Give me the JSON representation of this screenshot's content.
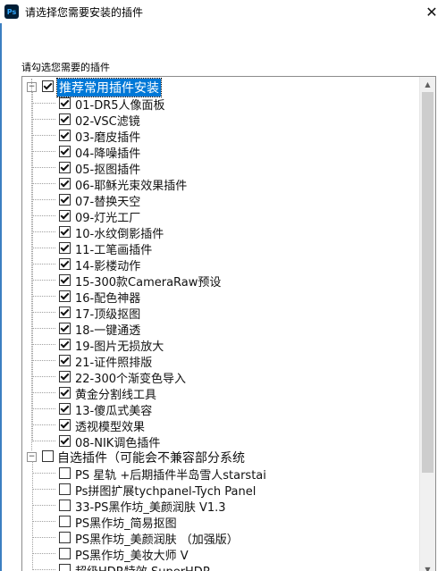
{
  "window": {
    "title": "请选择您需要安装的插件",
    "app_icon_text": "Ps",
    "close_glyph": "✕"
  },
  "prompt": "请勾选您需要的插件",
  "tree": {
    "groups": [
      {
        "label": "推荐常用插件安装",
        "checked": true,
        "expanded": true,
        "selected": true,
        "items": [
          {
            "label": "01-DR5人像面板",
            "checked": true
          },
          {
            "label": "02-VSC滤镜",
            "checked": true
          },
          {
            "label": "03-磨皮插件",
            "checked": true
          },
          {
            "label": "04-降噪插件",
            "checked": true
          },
          {
            "label": "05-抠图插件",
            "checked": true
          },
          {
            "label": "06-耶稣光束效果插件",
            "checked": true
          },
          {
            "label": "07-替换天空",
            "checked": true
          },
          {
            "label": "09-灯光工厂",
            "checked": true
          },
          {
            "label": "10-水纹倒影插件",
            "checked": true
          },
          {
            "label": "11-工笔画插件",
            "checked": true
          },
          {
            "label": "14-影楼动作",
            "checked": true
          },
          {
            "label": "15-300款CameraRaw预设",
            "checked": true
          },
          {
            "label": "16-配色神器",
            "checked": true
          },
          {
            "label": "17-顶级抠图",
            "checked": true
          },
          {
            "label": "18-一键通透",
            "checked": true
          },
          {
            "label": "19-图片无损放大",
            "checked": true
          },
          {
            "label": "21-证件照排版",
            "checked": true
          },
          {
            "label": "22-300个渐变色导入",
            "checked": true
          },
          {
            "label": "黄金分割线工具",
            "checked": true
          },
          {
            "label": "13-傻瓜式美容",
            "checked": true
          },
          {
            "label": "透视模型效果",
            "checked": true
          },
          {
            "label": "08-NIK调色插件",
            "checked": true
          }
        ]
      },
      {
        "label": "自选插件（可能会不兼容部分系统",
        "checked": false,
        "expanded": true,
        "selected": false,
        "items": [
          {
            "label": "PS 星轨 +后期插件半岛雪人starstai",
            "checked": false
          },
          {
            "label": "Ps拼图扩展tychpanel-Tych Panel",
            "checked": false
          },
          {
            "label": "33-PS黑作坊_美颜润肤 V1.3",
            "checked": false
          },
          {
            "label": "PS黑作坊_简易抠图",
            "checked": false
          },
          {
            "label": "PS黑作坊_美颜润肤 （加强版）",
            "checked": false
          },
          {
            "label": "PS黑作坊_美妆大师 V",
            "checked": false
          },
          {
            "label": "超级HDR特效 SuperHDR",
            "checked": false
          }
        ]
      }
    ]
  },
  "scrollbar": {
    "up_glyph": "▲",
    "down_glyph": "▼"
  }
}
